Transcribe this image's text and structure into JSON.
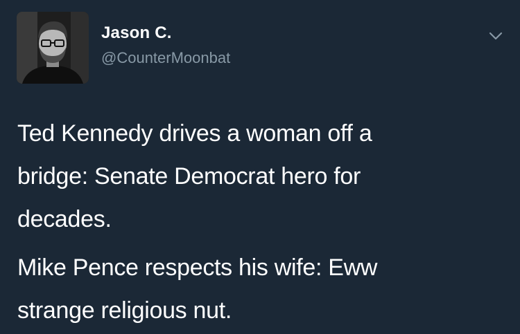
{
  "tweet": {
    "author": {
      "name": "Jason C.",
      "handle": "@CounterMoonbat",
      "avatar_icon": "profile-photo"
    },
    "menu_icon": "chevron-down-icon",
    "paragraphs": [
      {
        "lines": [
          "Ted Kennedy drives a woman off a",
          "bridge: Senate Democrat hero for",
          "decades."
        ]
      },
      {
        "lines": [
          "Mike Pence respects his wife: Eww",
          "strange religious nut."
        ]
      }
    ]
  },
  "colors": {
    "background": "#1b2836",
    "text": "#ffffff",
    "secondary_text": "#8899a6"
  }
}
